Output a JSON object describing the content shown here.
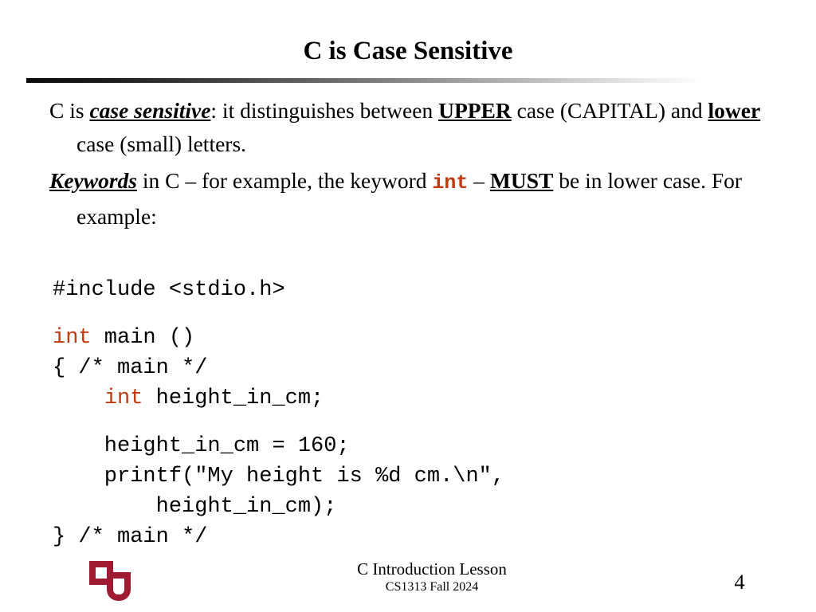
{
  "slide": {
    "title": "C is Case Sensitive",
    "bullets": [
      {
        "id": "bullet-case-sensitive",
        "segments": [
          {
            "text": "C is ",
            "style": "plain"
          },
          {
            "text": "case sensitive",
            "style": "bold-italic-underline"
          },
          {
            "text": ": it distinguishes between ",
            "style": "plain"
          },
          {
            "text": "UPPER",
            "style": "bold-underline"
          },
          {
            "text": " case (CAPITAL) and ",
            "style": "plain"
          },
          {
            "text": "lower",
            "style": "bold-underline"
          },
          {
            "text": " case (small) letters.",
            "style": "plain"
          }
        ]
      },
      {
        "id": "bullet-keywords",
        "segments": [
          {
            "text": "Keywords",
            "style": "bold-italic-underline"
          },
          {
            "text": " in C – for example, the keyword ",
            "style": "plain"
          },
          {
            "text": "int",
            "style": "keyword-mono"
          },
          {
            "text": " – ",
            "style": "plain"
          },
          {
            "text": "MUST",
            "style": "bold-underline"
          },
          {
            "text": " be in lower case. For example:",
            "style": "plain"
          }
        ]
      }
    ],
    "code": [
      {
        "id": "code-include",
        "tokens": [
          {
            "text": "#include <stdio.h>",
            "type": "plain"
          }
        ]
      },
      {
        "id": "code-blank-1",
        "tokens": [
          {
            "text": "",
            "type": "plain"
          }
        ],
        "blank": true
      },
      {
        "id": "code-main-decl",
        "tokens": [
          {
            "text": "int",
            "type": "keyword"
          },
          {
            "text": " main ()",
            "type": "plain"
          }
        ]
      },
      {
        "id": "code-open-brace",
        "tokens": [
          {
            "text": "{ /* main */",
            "type": "plain"
          }
        ]
      },
      {
        "id": "code-var-decl",
        "tokens": [
          {
            "text": "    ",
            "type": "plain"
          },
          {
            "text": "int",
            "type": "keyword"
          },
          {
            "text": " height_in_cm;",
            "type": "plain"
          }
        ]
      },
      {
        "id": "code-blank-2",
        "tokens": [
          {
            "text": "",
            "type": "plain"
          }
        ],
        "blank": true
      },
      {
        "id": "code-assign",
        "tokens": [
          {
            "text": "    height_in_cm = 160;",
            "type": "plain"
          }
        ]
      },
      {
        "id": "code-printf",
        "tokens": [
          {
            "text": "    printf(\"My height is %d cm.\\n\",",
            "type": "plain"
          }
        ]
      },
      {
        "id": "code-printf-arg",
        "tokens": [
          {
            "text": "        height_in_cm);",
            "type": "plain"
          }
        ]
      },
      {
        "id": "code-close-brace",
        "tokens": [
          {
            "text": "} /* main */",
            "type": "plain"
          }
        ]
      }
    ],
    "footer": {
      "lesson": "C Introduction Lesson",
      "course": "CS1313 Fall 2024",
      "slide_number": "4",
      "logo_name": "ou-logo"
    },
    "colors": {
      "keyword": "#C23A10",
      "logo_crimson": "#9E1B32",
      "text": "#000000",
      "background": "#FFFFFF"
    }
  }
}
